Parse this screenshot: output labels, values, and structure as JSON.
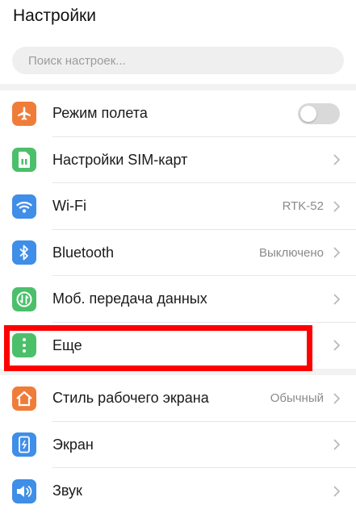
{
  "header": {
    "title": "Настройки"
  },
  "search": {
    "placeholder": "Поиск настроек..."
  },
  "settings": {
    "airplane": {
      "label": "Режим полета",
      "icon": "airplane-icon",
      "color": "#f07c3a",
      "toggle": false
    },
    "sim": {
      "label": "Настройки SIM-карт",
      "icon": "sim-card-icon",
      "color": "#4cbf6b"
    },
    "wifi": {
      "label": "Wi-Fi",
      "value": "RTK-52",
      "icon": "wifi-icon",
      "color": "#3f8ee8"
    },
    "bluetooth": {
      "label": "Bluetooth",
      "value": "Выключено",
      "icon": "bluetooth-icon",
      "color": "#3f8ee8"
    },
    "mobile_data": {
      "label": "Моб. передача данных",
      "icon": "mobile-data-icon",
      "color": "#4cbf6b"
    },
    "more": {
      "label": "Еще",
      "icon": "more-icon",
      "color": "#4cbf6b"
    },
    "home_style": {
      "label": "Стиль рабочего экрана",
      "value": "Обычный",
      "icon": "home-icon",
      "color": "#f07c3a"
    },
    "display": {
      "label": "Экран",
      "icon": "display-icon",
      "color": "#3f8ee8"
    },
    "sound": {
      "label": "Звук",
      "icon": "sound-icon",
      "color": "#3f8ee8"
    }
  },
  "highlight_color": "#ff0000"
}
